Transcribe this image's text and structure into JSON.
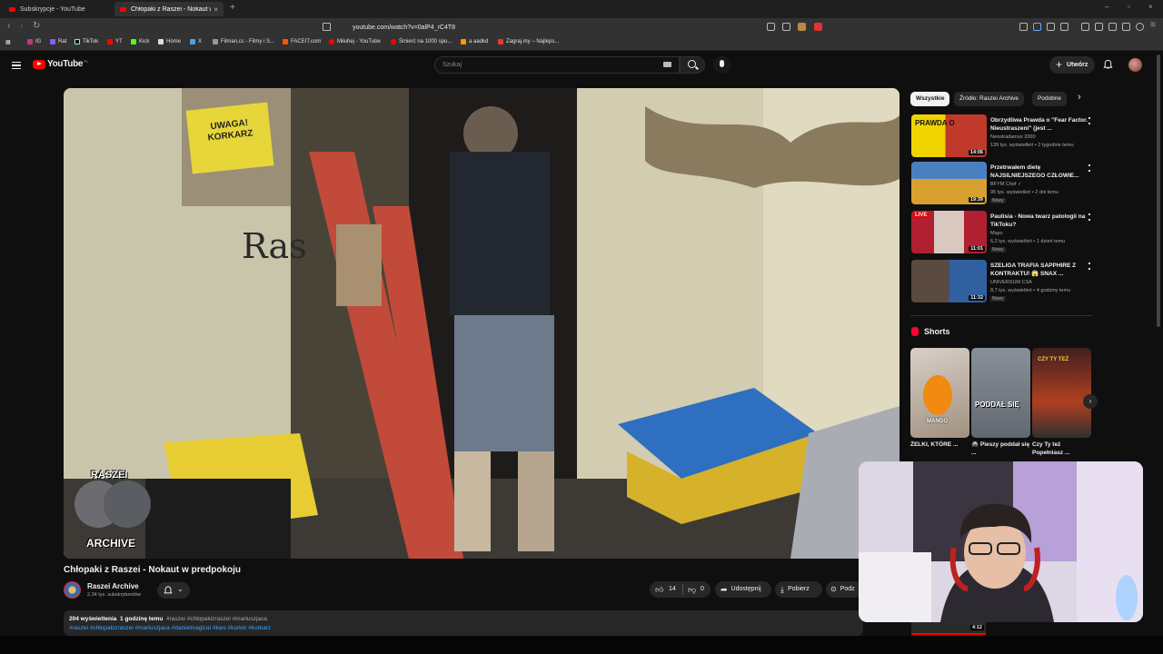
{
  "browser": {
    "tabs": [
      {
        "title": "Subskrypcje - YouTube",
        "active": false
      },
      {
        "title": "Chłopaki z Raszei - Nokaut w",
        "active": true
      }
    ],
    "url": "youtube.com/watch?v=0alP4_rC4T8",
    "bookmarks": [
      "IG",
      "Rat",
      "TikTok",
      "YT",
      "Kick",
      "Home",
      "X",
      "Filman.cc - Filmy i S...",
      "FACEIT.com",
      "Miłuhej - YouTube",
      "Śmierć na 1000 spo...",
      "a aadkd",
      "Zagraj.my – Najleps..."
    ]
  },
  "youtube": {
    "logo_text": "YouTube",
    "logo_country": "PL",
    "search_placeholder": "Szukaj",
    "create_label": "Utwórz"
  },
  "video": {
    "title": "Chłopaki z Raszei - Nokaut w predpokoju",
    "overlay_top": "RASZEI",
    "overlay_bottom": "ARCHIVE",
    "wall_sign": "UWAGA! KORKARZ",
    "watermark": "Ras",
    "channel_name": "Raszei Archive",
    "subscribers": "2,34 tys. subskrybentów",
    "likes": "14",
    "dislikes": "0",
    "share_label": "Udostępnij",
    "download_label": "Pobierz",
    "thanks_label": "Podz",
    "views": "204 wyświetlenia",
    "time_ago": "1 godzinę temu",
    "hashtags_inline": "#raszei #chłopakizraszei #marluszjaca",
    "hashtags_line2": "#raszei #chłopakizraszei #marluszjaca #danielmagical #kws #korkin #korkarz"
  },
  "chips": [
    "Wszystkie",
    "Źródło: Raszei Archive",
    "Podobne"
  ],
  "recommendations": [
    {
      "title": "Obrzydliwa Prawda o \"Fear Factor. Nieustraszeni\" (jest ...",
      "channel": "Neostradamus 2000",
      "meta": "139 tys. wyświetleń • 2 tygodnie temu",
      "badge": "",
      "duration": "14:06",
      "thumb_text": "PRAWDA O"
    },
    {
      "title": "Przetrwałem dietę NAJSILNIEJSZEGO CZŁOWIE...",
      "channel": "BFYM Chef ✓",
      "meta": "95 tys. wyświetleń • 2 dni temu",
      "badge": "Nowy",
      "duration": "19:39",
      "thumb_text": ""
    },
    {
      "title": "Paulisia - Nowa twarz patologii na TikToku?",
      "channel": "Mayo",
      "meta": "6,2 tys. wyświetleń • 1 dzień temu",
      "badge": "Nowy",
      "duration": "11:01",
      "thumb_text": "LIVE"
    },
    {
      "title": "SZELIGA TRAFIA SAPPHIRE Z KONTRAKTU! 😱 SNAX ...",
      "channel": "UNIVERSUM CSA",
      "meta": "8,7 tys. wyświetleń • 4 godziny temu",
      "badge": "Nowy",
      "duration": "11:32",
      "thumb_text": ""
    }
  ],
  "shorts": {
    "heading": "Shorts",
    "items": [
      {
        "title": "ŻELKI, KTÓRE ...",
        "thumb_text": "MANGO"
      },
      {
        "title": "🚔 Pieszy poddał się ...",
        "thumb_text": "PODDAŁ SIĘ"
      },
      {
        "title": "Czy Ty też Popełniasz ...",
        "thumb_text": "CZY TY TEŻ"
      }
    ]
  },
  "bottom_mini": {
    "duration": "4:12"
  },
  "colors": {
    "accent": "#ff0000",
    "link": "#3ea6ff",
    "bg": "#0f0f0f",
    "surface": "#272727"
  }
}
